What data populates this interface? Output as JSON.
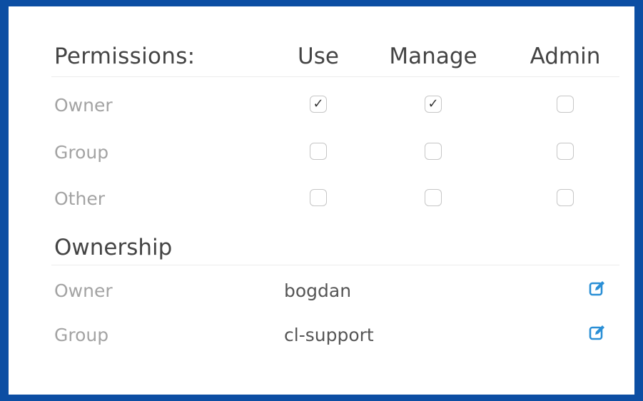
{
  "permissions": {
    "title": "Permissions:",
    "columns": [
      "Use",
      "Manage",
      "Admin"
    ],
    "rows": [
      {
        "label": "Owner",
        "checks": [
          true,
          true,
          false
        ]
      },
      {
        "label": "Group",
        "checks": [
          false,
          false,
          false
        ]
      },
      {
        "label": "Other",
        "checks": [
          false,
          false,
          false
        ]
      }
    ]
  },
  "ownership": {
    "title": "Ownership",
    "rows": [
      {
        "label": "Owner",
        "value": "bogdan",
        "icon": "edit-icon"
      },
      {
        "label": "Group",
        "value": "cl-support",
        "icon": "edit-icon"
      }
    ]
  },
  "colors": {
    "border": "#0c4ea3",
    "accent": "#2a8fd6"
  }
}
